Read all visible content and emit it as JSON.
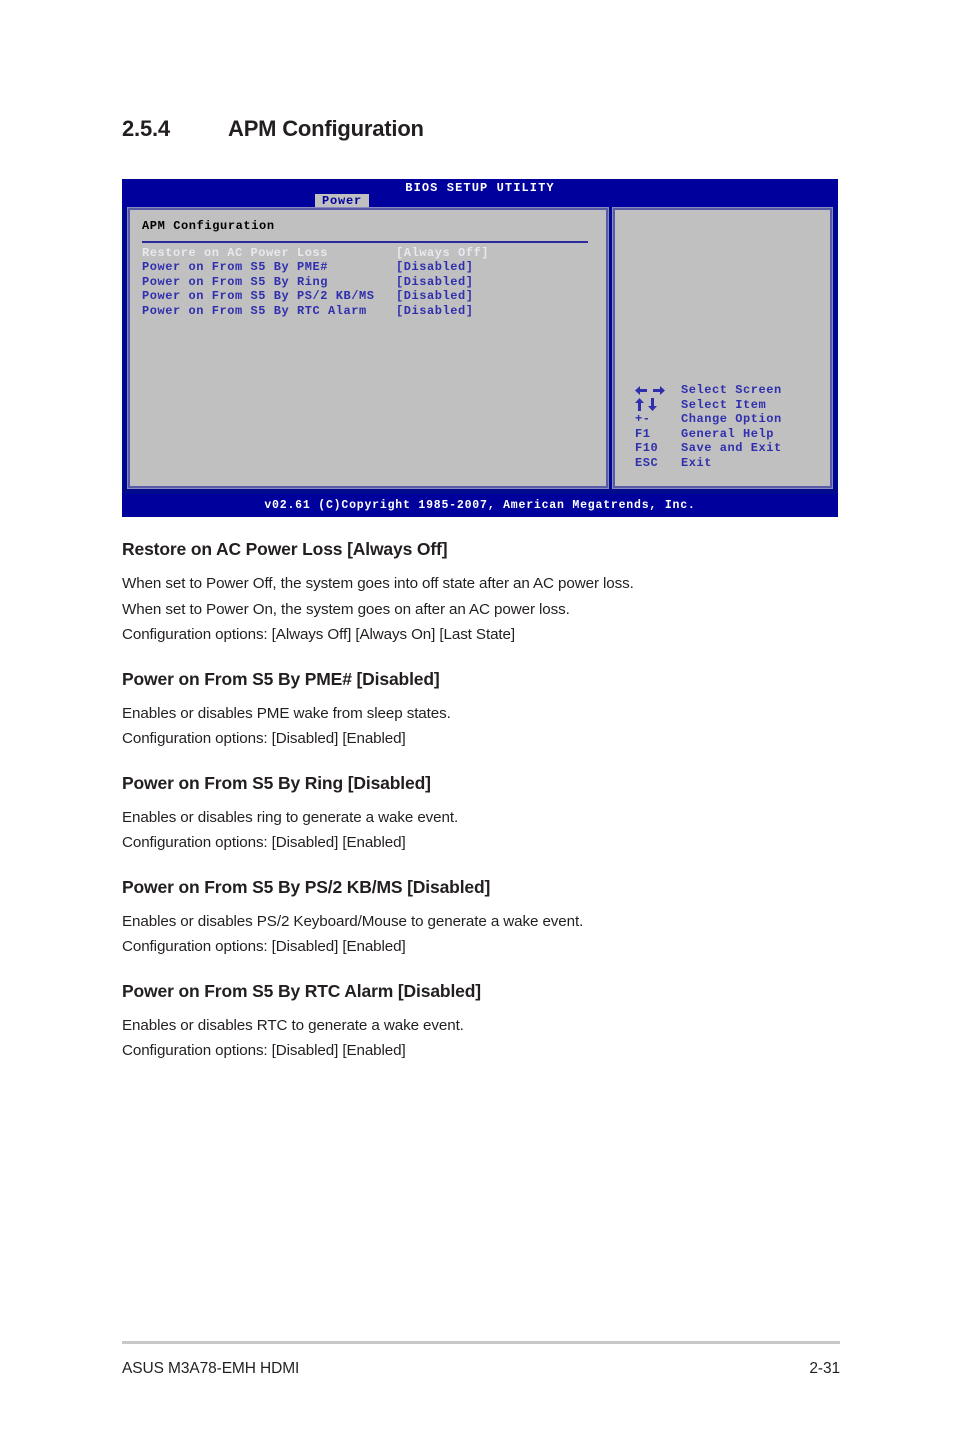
{
  "section": {
    "number": "2.5.4",
    "title": "APM Configuration"
  },
  "bios": {
    "title": "BIOS SETUP UTILITY",
    "tab": "Power",
    "panel_heading": "APM Configuration",
    "options": [
      {
        "label": "Restore on AC Power Loss",
        "value": "[Always Off]",
        "selected": true
      },
      {
        "label": "Power on From S5 By PME#",
        "value": "[Disabled]",
        "selected": false
      },
      {
        "label": "Power on From S5 By Ring",
        "value": "[Disabled]",
        "selected": false
      },
      {
        "label": "Power on From S5 By PS/2 KB/MS",
        "value": "[Disabled]",
        "selected": false
      },
      {
        "label": "Power on From S5 By RTC Alarm",
        "value": "[Disabled]",
        "selected": false
      }
    ],
    "keys": [
      {
        "glyph": "left-right-arrows-icon",
        "key": "",
        "desc": "Select Screen"
      },
      {
        "glyph": "up-down-arrows-icon",
        "key": "",
        "desc": "Select Item"
      },
      {
        "glyph": "text",
        "key": "+-",
        "desc": "Change Option"
      },
      {
        "glyph": "text",
        "key": "F1",
        "desc": "General Help"
      },
      {
        "glyph": "text",
        "key": "F10",
        "desc": "Save and Exit"
      },
      {
        "glyph": "text",
        "key": "ESC",
        "desc": "Exit"
      }
    ],
    "footer": "v02.61 (C)Copyright 1985-2007, American Megatrends, Inc.",
    "colors": {
      "background": "#00009c",
      "panel": "#c0c0c0",
      "option_text": "#2f2fae",
      "selected_text": "#e8e8ef",
      "rule": "#2a2a9c"
    }
  },
  "blocks": [
    {
      "heading": "Restore on AC Power Loss [Always Off]",
      "lines": [
        "When set to Power Off, the system goes into off state after an AC power loss.",
        "When set to Power On, the system goes on after an AC power loss.",
        "Configuration options: [Always Off] [Always On] [Last State]"
      ]
    },
    {
      "heading": "Power on From S5 By PME# [Disabled]",
      "lines": [
        "Enables or disables PME wake from sleep states.",
        "Configuration options: [Disabled] [Enabled]"
      ]
    },
    {
      "heading": "Power on From S5 By Ring [Disabled]",
      "lines": [
        "Enables or disables ring to generate a wake event.",
        "Configuration options: [Disabled] [Enabled]"
      ]
    },
    {
      "heading": "Power on From S5 By PS/2 KB/MS [Disabled]",
      "lines": [
        "Enables or disables PS/2 Keyboard/Mouse to generate a wake event.",
        "Configuration options: [Disabled] [Enabled]"
      ]
    },
    {
      "heading": "Power on From S5 By RTC Alarm [Disabled]",
      "lines": [
        "Enables or disables RTC to generate a wake event.",
        "Configuration options: [Disabled] [Enabled]"
      ]
    }
  ],
  "page_footer": {
    "left": "ASUS M3A78-EMH HDMI",
    "right": "2-31"
  }
}
